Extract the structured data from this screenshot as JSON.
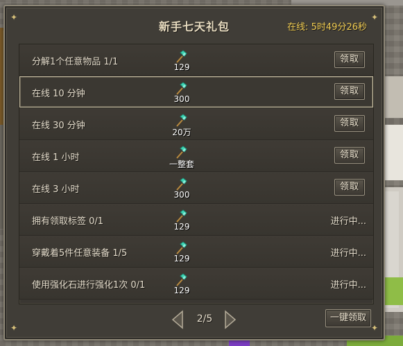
{
  "window": {
    "title": "新手七天礼包",
    "online_status": "在线: 5时49分26秒"
  },
  "colors": {
    "accent_gold": "#f0cc52",
    "reward_icon": "#3fd6b4"
  },
  "tasks": [
    {
      "label": "分解1个任意物品 1/1",
      "reward_icon": "diamond-hammer-icon",
      "reward_amount": "129",
      "action": "领取",
      "state": "claimable"
    },
    {
      "label": "在线 10 分钟",
      "reward_icon": "diamond-hammer-icon",
      "reward_amount": "300",
      "action": "领取",
      "state": "claimable"
    },
    {
      "label": "在线 30 分钟",
      "reward_icon": "diamond-hammer-icon",
      "reward_amount": "20万",
      "action": "领取",
      "state": "claimable"
    },
    {
      "label": "在线 1 小时",
      "reward_icon": "diamond-hammer-icon",
      "reward_amount": "一整套",
      "action": "领取",
      "state": "claimable"
    },
    {
      "label": "在线 3 小时",
      "reward_icon": "diamond-hammer-icon",
      "reward_amount": "300",
      "action": "领取",
      "state": "claimable"
    },
    {
      "label": "拥有领取标签 0/1",
      "reward_icon": "diamond-hammer-icon",
      "reward_amount": "129",
      "action": "进行中...",
      "state": "in_progress"
    },
    {
      "label": "穿戴着5件任意装备 1/5",
      "reward_icon": "diamond-hammer-icon",
      "reward_amount": "129",
      "action": "进行中...",
      "state": "in_progress"
    },
    {
      "label": "使用强化石进行强化1次 0/1",
      "reward_icon": "diamond-hammer-icon",
      "reward_amount": "129",
      "action": "进行中...",
      "state": "in_progress"
    }
  ],
  "selected_task": 1,
  "pagination": {
    "page": "2/5",
    "claim_all": "一键领取"
  }
}
